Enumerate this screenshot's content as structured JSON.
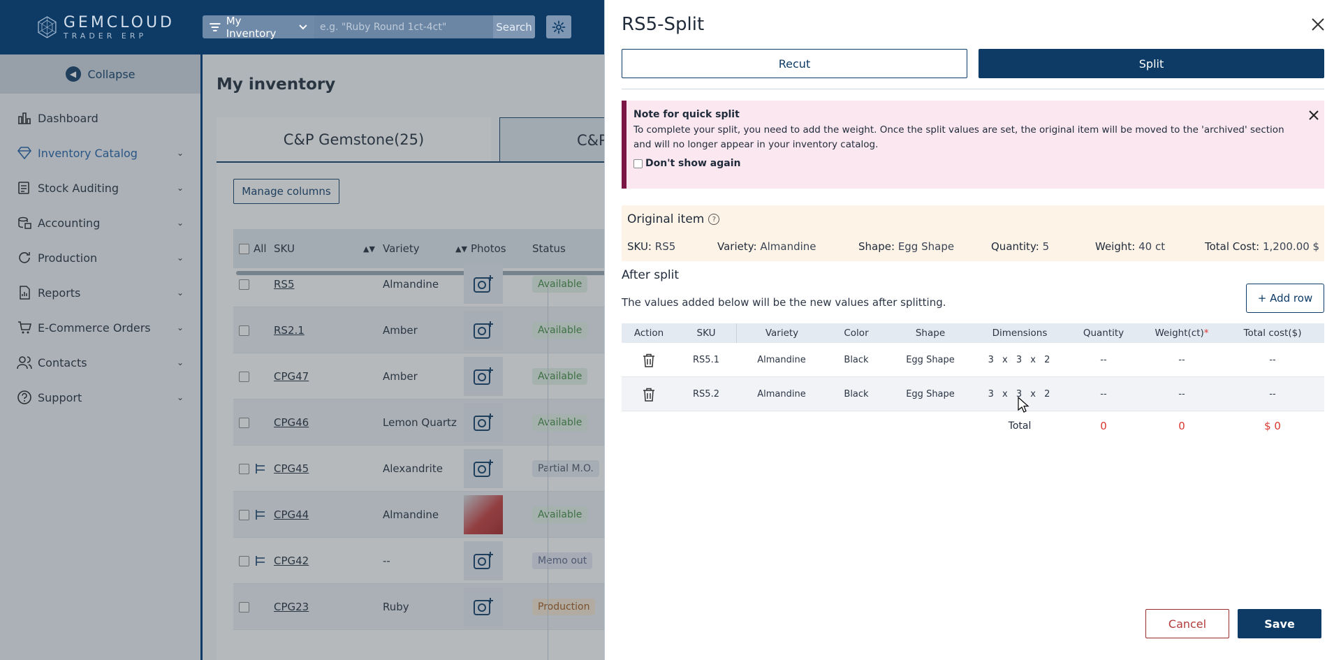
{
  "app": {
    "logo_name": "GEMCLOUD",
    "logo_sub": "TRADER ERP",
    "filter_label": "My Inventory",
    "search_placeholder": "e.g. \"Ruby Round 1ct-4ct\"",
    "search_button": "Search"
  },
  "sidebar": {
    "collapse_label": "Collapse",
    "items": [
      {
        "label": "Dashboard",
        "icon": "dashboard-icon"
      },
      {
        "label": "Inventory Catalog",
        "icon": "gem-icon"
      },
      {
        "label": "Stock Auditing",
        "icon": "audit-icon"
      },
      {
        "label": "Accounting",
        "icon": "accounting-icon"
      },
      {
        "label": "Production",
        "icon": "production-icon"
      },
      {
        "label": "Reports",
        "icon": "reports-icon"
      },
      {
        "label": "E-Commerce Orders",
        "icon": "cart-icon"
      },
      {
        "label": "Contacts",
        "icon": "contacts-icon"
      },
      {
        "label": "Support",
        "icon": "support-icon"
      }
    ]
  },
  "inventory": {
    "title": "My inventory",
    "tab_gemstone": "C&P Gemstone(25)",
    "tab_other": "C&P",
    "manage_columns": "Manage columns",
    "headers": {
      "all": "All",
      "sku": "SKU",
      "variety": "Variety",
      "photos": "Photos",
      "status": "Status"
    },
    "rows": [
      {
        "sku": "RS5",
        "variety": "Almandine",
        "status": "Available",
        "status_type": "available",
        "photo": "placeholder",
        "split": false
      },
      {
        "sku": "RS2.1",
        "variety": "Amber",
        "status": "Available",
        "status_type": "available",
        "photo": "placeholder",
        "split": false
      },
      {
        "sku": "CPG47",
        "variety": "Amber",
        "status": "Available",
        "status_type": "available",
        "photo": "placeholder",
        "split": false
      },
      {
        "sku": "CPG46",
        "variety": "Lemon Quartz",
        "status": "Available",
        "status_type": "available",
        "photo": "placeholder",
        "split": false
      },
      {
        "sku": "CPG45",
        "variety": "Alexandrite",
        "status": "Partial M.O.",
        "status_type": "partial",
        "photo": "placeholder",
        "split": true
      },
      {
        "sku": "CPG44",
        "variety": "Almandine",
        "status": "Available",
        "status_type": "available",
        "photo": "image",
        "split": true
      },
      {
        "sku": "CPG42",
        "variety": "--",
        "status": "Memo out",
        "status_type": "memo",
        "photo": "placeholder",
        "split": true
      },
      {
        "sku": "CPG23",
        "variety": "Ruby",
        "status": "Production",
        "status_type": "prod",
        "photo": "placeholder",
        "split": false
      }
    ]
  },
  "modal": {
    "title": "RS5-Split",
    "recut_label": "Recut",
    "split_label": "Split",
    "note": {
      "title": "Note for quick split",
      "body": "To complete your split, you need to add the weight. Once the split values are set, the original item will be moved to the 'archived' section and will no longer appear in your inventory catalog.",
      "dont_show": "Don't show again"
    },
    "original": {
      "title": "Original item",
      "fields": [
        {
          "label": "SKU:",
          "value": "RS5"
        },
        {
          "label": "Variety:",
          "value": "Almandine"
        },
        {
          "label": "Shape:",
          "value": "Egg Shape"
        },
        {
          "label": "Quantity:",
          "value": "5"
        },
        {
          "label": "Weight:",
          "value": "40 ct"
        },
        {
          "label": "Total Cost:",
          "value": "1,200.00 $"
        }
      ]
    },
    "after": {
      "title": "After split",
      "desc": "The values added below will be the new values after splitting.",
      "add_row": "+ Add row",
      "headers": {
        "action": "Action",
        "sku": "SKU",
        "variety": "Variety",
        "color": "Color",
        "shape": "Shape",
        "dimensions": "Dimensions",
        "quantity": "Quantity",
        "weight": "Weight(ct)",
        "weight_req": "*",
        "cost": "Total cost($)"
      },
      "rows": [
        {
          "sku": "RS5.1",
          "variety": "Almandine",
          "color": "Black",
          "shape": "Egg Shape",
          "dimensions": "3 x 3 x 2",
          "quantity": "--",
          "weight": "--",
          "cost": "--"
        },
        {
          "sku": "RS5.2",
          "variety": "Almandine",
          "color": "Black",
          "shape": "Egg Shape",
          "dimensions": "3 x 3 x 2",
          "quantity": "--",
          "weight": "--",
          "cost": "--"
        }
      ],
      "total": {
        "label": "Total",
        "quantity": "0",
        "weight": "0",
        "cost": "$ 0"
      }
    },
    "cancel": "Cancel",
    "save": "Save"
  },
  "colors": {
    "primary": "#0d3b66",
    "danger": "#d9372f",
    "note_bg": "#fbe7ef",
    "original_bg": "#fdf3e6"
  }
}
